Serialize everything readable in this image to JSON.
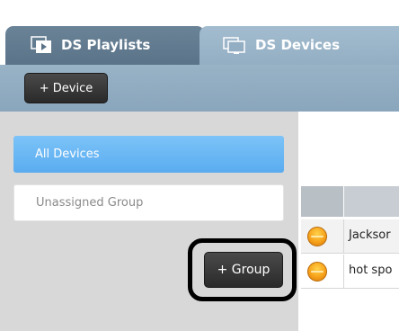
{
  "tabs": [
    {
      "label": "DS Playlists",
      "icon": "playlist-icon",
      "active": false
    },
    {
      "label": "DS Devices",
      "icon": "devices-icon",
      "active": true
    }
  ],
  "toolbar": {
    "add_device_label": "+ Device"
  },
  "sidebar": {
    "items": [
      {
        "label": "All Devices",
        "selected": true
      },
      {
        "label": "Unassigned Group",
        "selected": false
      }
    ],
    "add_group_label": "+ Group"
  },
  "devices": {
    "rows": [
      {
        "status": "orange",
        "name": "Jacksor"
      },
      {
        "status": "orange",
        "name": "hot spo"
      }
    ]
  },
  "colors": {
    "selected_item": "#5aacf0",
    "toolbar": "#8aa6bc",
    "status_orange": "#f7a21b"
  }
}
